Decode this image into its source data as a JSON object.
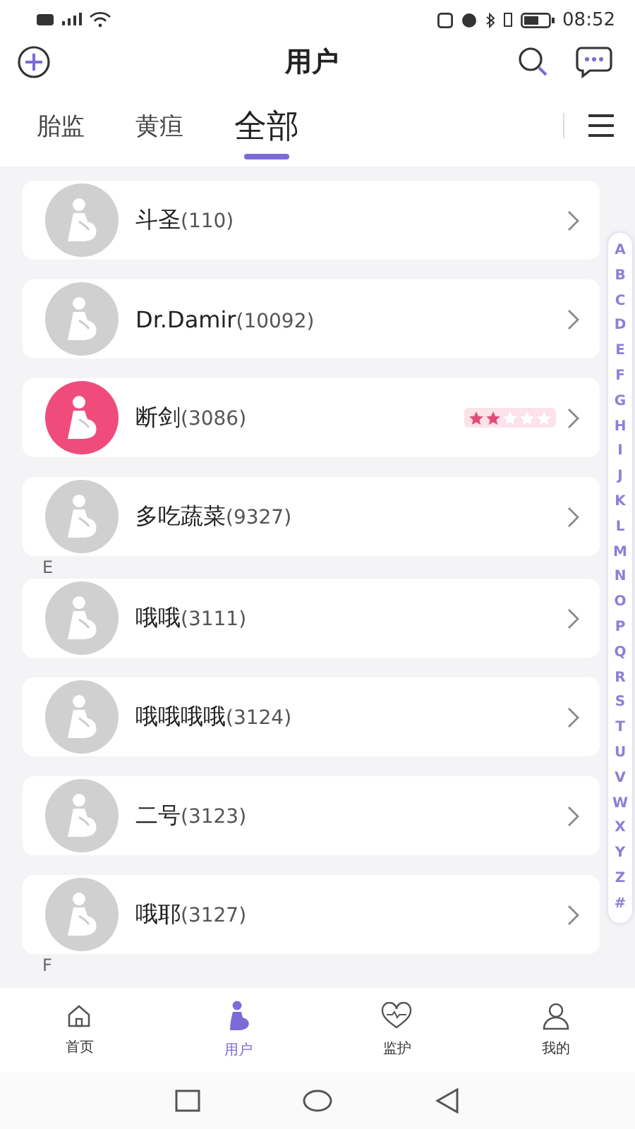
{
  "status_bar": {
    "time": "08:52"
  },
  "header": {
    "title": "用户"
  },
  "tabs": [
    {
      "label": "胎监",
      "selected": false
    },
    {
      "label": "黄疸",
      "selected": false
    },
    {
      "label": "全部",
      "selected": true
    }
  ],
  "list": [
    {
      "kind": "user",
      "name": "斗圣",
      "count": "(110)",
      "color": "#d0d0d0"
    },
    {
      "kind": "user",
      "name": "Dr.Damir",
      "count": "(10092)",
      "color": "#d0d0d0"
    },
    {
      "kind": "user",
      "name": "断剑",
      "count": "(3086)",
      "color": "#ef4c7c",
      "stars": 2
    },
    {
      "kind": "user",
      "name": "多吃蔬菜",
      "count": "(9327)",
      "color": "#d0d0d0"
    },
    {
      "kind": "section",
      "letter": "E"
    },
    {
      "kind": "user",
      "name": "哦哦",
      "count": "(3111)",
      "color": "#d0d0d0"
    },
    {
      "kind": "user",
      "name": "哦哦哦哦",
      "count": "(3124)",
      "color": "#d0d0d0"
    },
    {
      "kind": "user",
      "name": "二号",
      "count": "(3123)",
      "color": "#d0d0d0"
    },
    {
      "kind": "user",
      "name": "哦耶",
      "count": "(3127)",
      "color": "#d0d0d0"
    },
    {
      "kind": "section",
      "letter": "F"
    }
  ],
  "index": [
    "A",
    "B",
    "C",
    "D",
    "E",
    "F",
    "G",
    "H",
    "I",
    "J",
    "K",
    "L",
    "M",
    "N",
    "O",
    "P",
    "Q",
    "R",
    "S",
    "T",
    "U",
    "V",
    "W",
    "X",
    "Y",
    "Z",
    "#"
  ],
  "bottom_nav": [
    {
      "kind": "home",
      "label": "首页",
      "selected": false
    },
    {
      "kind": "users",
      "label": "用户",
      "selected": true
    },
    {
      "kind": "monitor",
      "label": "监护",
      "selected": false
    },
    {
      "kind": "profile",
      "label": "我的",
      "selected": false
    }
  ]
}
